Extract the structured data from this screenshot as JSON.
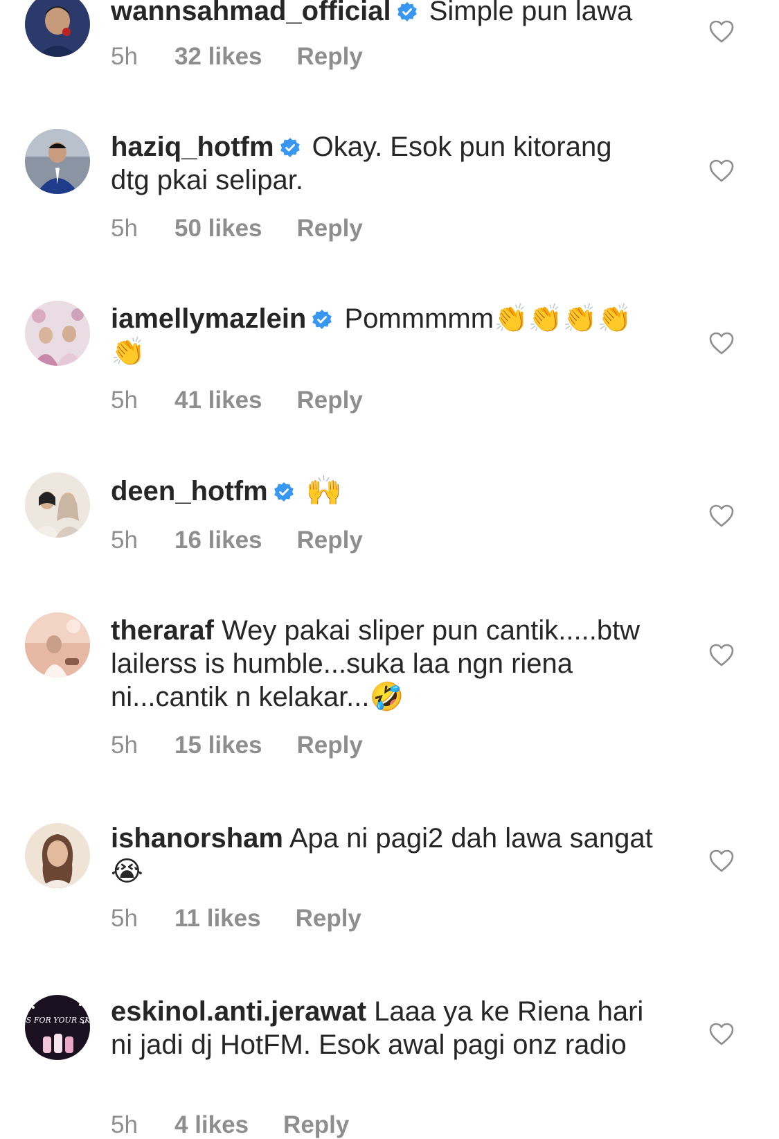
{
  "colors": {
    "text": "#262626",
    "meta": "#8e8e8e",
    "verified": "#3897f0"
  },
  "comments": [
    {
      "username": "wannsahmad_official",
      "verified": true,
      "text": "Simple pun lawa",
      "time": "5h",
      "likes": "32 likes",
      "reply": "Reply"
    },
    {
      "username": "haziq_hotfm",
      "verified": true,
      "text": "Okay. Esok pun kitorang dtg pkai selipar.",
      "time": "5h",
      "likes": "50 likes",
      "reply": "Reply"
    },
    {
      "username": "iamellymazlein",
      "verified": true,
      "text": "Pommmmm👏👏👏👏👏",
      "time": "5h",
      "likes": "41 likes",
      "reply": "Reply"
    },
    {
      "username": "deen_hotfm",
      "verified": true,
      "text": "🙌",
      "time": "5h",
      "likes": "16 likes",
      "reply": "Reply"
    },
    {
      "username": "theraraf",
      "verified": false,
      "text": "Wey pakai sliper pun cantik.....btw lailerss is humble...suka laa ngn riena ni...cantik n kelakar...🤣",
      "time": "5h",
      "likes": "15 likes",
      "reply": "Reply"
    },
    {
      "username": "ishanorsham",
      "verified": false,
      "text": "Apa ni pagi2 dah lawa sangat 😭",
      "time": "5h",
      "likes": "11 likes",
      "reply": "Reply"
    },
    {
      "username": "eskinol.anti.jerawat",
      "verified": false,
      "text": "Laaa ya ke Riena hari ni jadi dj HotFM. Esok awal pagi onz radio",
      "time": "5h",
      "likes": "4 likes",
      "reply": "Reply"
    }
  ],
  "avatar_logo_text": "BES FOR YOUR SKIN"
}
